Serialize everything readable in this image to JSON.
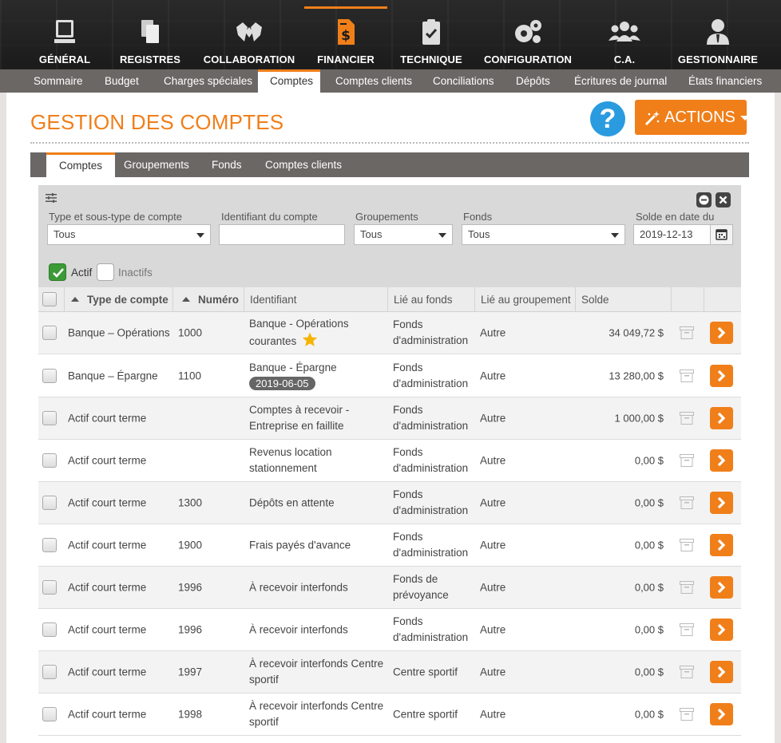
{
  "topnav": [
    {
      "label": "GÉNÉRAL",
      "icon": "desktop-icon"
    },
    {
      "label": "REGISTRES",
      "icon": "copy-icon"
    },
    {
      "label": "COLLABORATION",
      "icon": "handshake-icon"
    },
    {
      "label": "FINANCIER",
      "icon": "invoice-dollar-icon",
      "active": true
    },
    {
      "label": "TECHNIQUE",
      "icon": "clipboard-check-icon"
    },
    {
      "label": "CONFIGURATION",
      "icon": "gears-icon"
    },
    {
      "label": "C.A.",
      "icon": "users-icon"
    },
    {
      "label": "GESTIONNAIRE",
      "icon": "user-tie-icon"
    }
  ],
  "subnav": [
    {
      "label": "Sommaire"
    },
    {
      "label": "Budget"
    },
    {
      "label": "Charges spéciales"
    },
    {
      "label": "Comptes",
      "active": true
    },
    {
      "label": "Comptes clients"
    },
    {
      "label": "Conciliations"
    },
    {
      "label": "Dépôts"
    },
    {
      "label": "Écritures de journal"
    },
    {
      "label": "États financiers"
    }
  ],
  "page": {
    "title": "GESTION DES COMPTES",
    "help_label": "?",
    "actions_label": "ACTIONS"
  },
  "tabs": [
    {
      "label": "Comptes",
      "active": true
    },
    {
      "label": "Groupements"
    },
    {
      "label": "Fonds"
    },
    {
      "label": "Comptes clients"
    }
  ],
  "filters": {
    "type_label": "Type et sous-type de compte",
    "type_value": "Tous",
    "identifier_label": "Identifiant du compte",
    "identifier_value": "",
    "groupements_label": "Groupements",
    "groupements_value": "Tous",
    "fonds_label": "Fonds",
    "fonds_value": "Tous",
    "solde_label": "Solde en date du",
    "solde_value": "2019-12-13",
    "actif_label": "Actif",
    "actif_checked": true,
    "inactifs_label": "Inactifs",
    "inactifs_checked": false
  },
  "table": {
    "headers": {
      "type": "Type de compte",
      "numero": "Numéro",
      "identifiant": "Identifiant",
      "fonds": "Lié au fonds",
      "groupement": "Lié au groupement",
      "solde": "Solde"
    },
    "rows": [
      {
        "type": "Banque – Opérations",
        "numero": "1000",
        "identifiant": "Banque - Opérations courantes",
        "star": true,
        "fonds": "Fonds d'administration",
        "groupement": "Autre",
        "solde": "34 049,72 $"
      },
      {
        "type": "Banque – Épargne",
        "numero": "1100",
        "identifiant": "Banque - Épargne",
        "badge": "2019-06-05",
        "fonds": "Fonds d'administration",
        "groupement": "Autre",
        "solde": "13 280,00 $"
      },
      {
        "type": "Actif court terme",
        "numero": "",
        "identifiant": "Comptes à recevoir - Entreprise en faillite",
        "fonds": "Fonds d'administration",
        "groupement": "Autre",
        "solde": "1 000,00 $"
      },
      {
        "type": "Actif court terme",
        "numero": "",
        "identifiant": "Revenus location stationnement",
        "fonds": "Fonds d'administration",
        "groupement": "Autre",
        "solde": "0,00 $"
      },
      {
        "type": "Actif court terme",
        "numero": "1300",
        "identifiant": "Dépôts en attente",
        "fonds": "Fonds d'administration",
        "groupement": "Autre",
        "solde": "0,00 $"
      },
      {
        "type": "Actif court terme",
        "numero": "1900",
        "identifiant": "Frais payés d'avance",
        "fonds": "Fonds d'administration",
        "groupement": "Autre",
        "solde": "0,00 $"
      },
      {
        "type": "Actif court terme",
        "numero": "1996",
        "identifiant": "À recevoir interfonds",
        "fonds": "Fonds de prévoyance",
        "groupement": "Autre",
        "solde": "0,00 $"
      },
      {
        "type": "Actif court terme",
        "numero": "1996",
        "identifiant": "À recevoir interfonds",
        "fonds": "Fonds d'administration",
        "groupement": "Autre",
        "solde": "0,00 $"
      },
      {
        "type": "Actif court terme",
        "numero": "1997",
        "identifiant": "À recevoir interfonds Centre sportif",
        "fonds": "Centre sportif",
        "groupement": "Autre",
        "solde": "0,00 $"
      },
      {
        "type": "Actif court terme",
        "numero": "1998",
        "identifiant": "À recevoir interfonds Centre sportif",
        "fonds": "Centre sportif",
        "groupement": "Autre",
        "solde": "0,00 $"
      }
    ]
  },
  "colors": {
    "accent": "#f07f1a",
    "help": "#2b9be0",
    "topbar": "#1f1f1f",
    "subnav": "#6b6765",
    "active_check": "#3c9a37",
    "star": "#f5b400"
  }
}
